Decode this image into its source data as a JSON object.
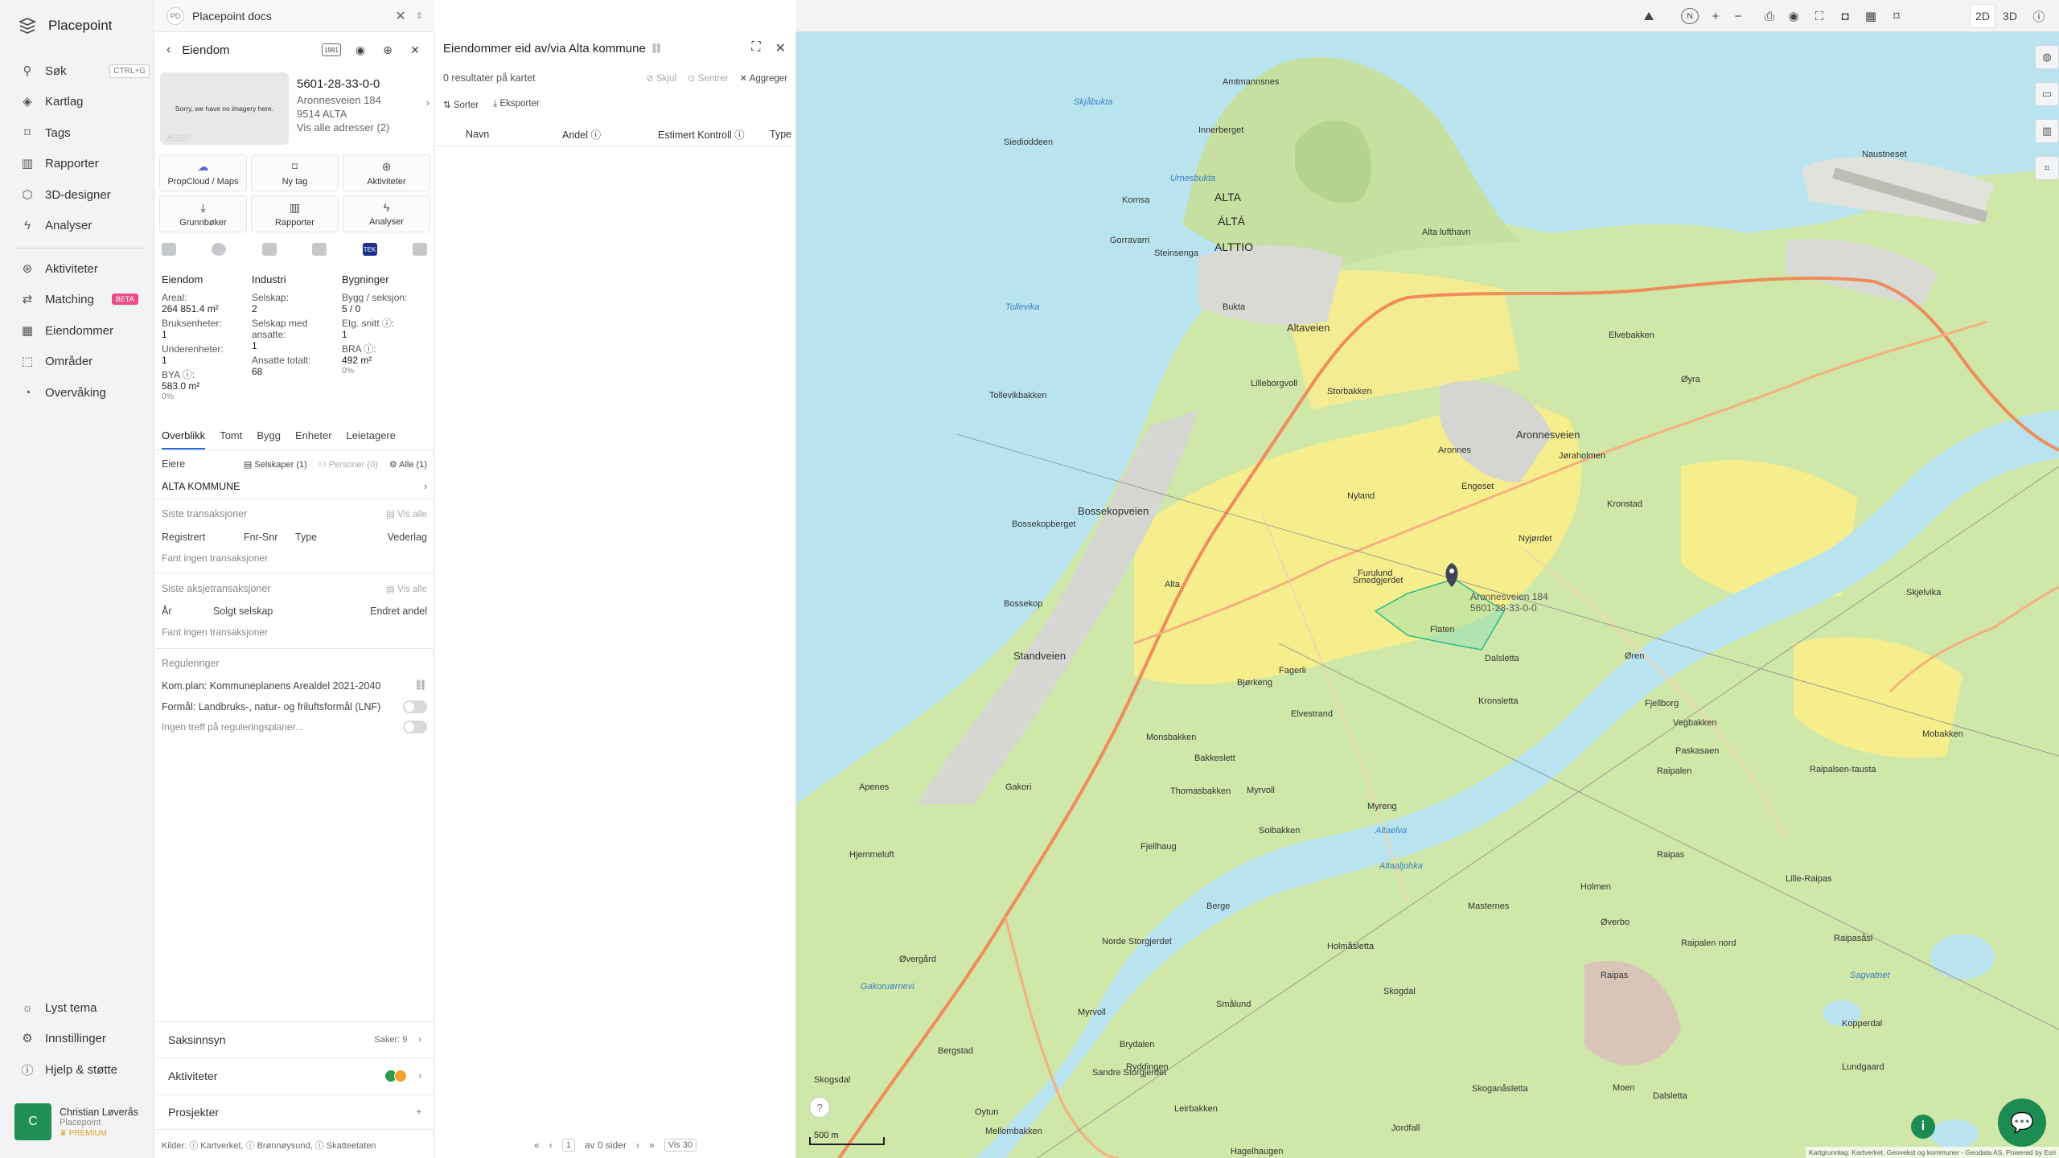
{
  "app": {
    "name": "Placepoint"
  },
  "nav": {
    "items": [
      {
        "label": "Søk",
        "icon": "search-icon",
        "shortcut": "CTRL+G"
      },
      {
        "label": "Kartlag",
        "icon": "layers-icon"
      },
      {
        "label": "Tags",
        "icon": "bookmark-icon"
      },
      {
        "label": "Rapporter",
        "icon": "bar-chart-icon"
      },
      {
        "label": "3D-designer",
        "icon": "cube-icon"
      },
      {
        "label": "Analyser",
        "icon": "bolt-icon"
      },
      {
        "label": "Aktiviteter",
        "icon": "activity-icon"
      },
      {
        "label": "Matching",
        "icon": "matching-icon",
        "badge": "BETA"
      },
      {
        "label": "Eiendommer",
        "icon": "building-icon"
      },
      {
        "label": "Områder",
        "icon": "area-icon"
      },
      {
        "label": "Overvåking",
        "icon": "monitor-icon"
      }
    ],
    "bottom": [
      {
        "label": "Lyst tema",
        "icon": "sun-icon"
      },
      {
        "label": "Innstillinger",
        "icon": "gear-icon"
      },
      {
        "label": "Hjelp & støtte",
        "icon": "help-icon"
      }
    ]
  },
  "user": {
    "initial": "C",
    "name": "Christian Løverås",
    "org": "Placepoint",
    "plan": "PREMIUM"
  },
  "docs_tab": {
    "badge": "PD",
    "title": "Placepoint docs"
  },
  "property": {
    "header": "Eiendom",
    "badge": "1981",
    "no_image": "Sorry, we have no imagery here.",
    "image_credit": "Google",
    "id": "5601-28-33-0-0",
    "street": "Aronnesveien 184",
    "postal": "9514 ALTA",
    "all_addresses": "Vis alle adresser (2)",
    "buttons": [
      "PropCloud / Maps",
      "Ny tag",
      "Aktiviteter",
      "Grunnbøker",
      "Rapporter",
      "Analyser"
    ],
    "source_tek": "TEK",
    "stats": {
      "eiendom": {
        "heading": "Eiendom",
        "areal_label": "Areal:",
        "areal": "264 851.4 m²",
        "bruks_label": "Bruksenheter:",
        "bruks": "1",
        "under_label": "Underenheter:",
        "under": "1",
        "bya_label": "BYA ⓘ:",
        "bya": "583.0 m²",
        "bya_pct": "0%"
      },
      "industri": {
        "heading": "Industri",
        "selskap_label": "Selskap:",
        "selskap": "2",
        "ansatte_label": "Selskap med ansatte:",
        "ansatte": "1",
        "total_label": "Ansatte totalt:",
        "total": "68"
      },
      "bygninger": {
        "heading": "Bygninger",
        "bygg_label": "Bygg / seksjon:",
        "bygg": "5 / 0",
        "etg_label": "Etg. snitt ⓘ:",
        "etg": "1",
        "bra_label": "BRA ⓘ:",
        "bra": "492 m²",
        "bra_pct": "0%"
      }
    },
    "tabs": [
      "Overblikk",
      "Tomt",
      "Bygg",
      "Enheter",
      "Leietagere"
    ],
    "owners": {
      "label": "Eiere",
      "companies": "Selskaper (1)",
      "persons": "Personer (0)",
      "all": "Alle (1)",
      "owner": "ALTA KOMMUNE"
    },
    "transactions": {
      "label": "Siste transaksjoner",
      "show_all": "Vis alle",
      "cols": [
        "Registrert",
        "Fnr-Snr",
        "Type",
        "Vederlag"
      ],
      "empty": "Fant ingen transaksjoner"
    },
    "share_tx": {
      "label": "Siste aksjetransaksjoner",
      "show_all": "Vis alle",
      "cols": [
        "År",
        "Solgt selskap",
        "Endret andel"
      ],
      "empty": "Fant ingen transaksjoner"
    },
    "regulations": {
      "label": "Reguleringer",
      "komplan": "Kom.plan: Kommuneplanens Arealdel 2021-2040",
      "formal": "Formål: Landbruks-, natur- og friluftsformål (LNF)",
      "none": "Ingen treff på reguleringsplaner..."
    },
    "accordion": [
      {
        "label": "Saksinnsyn",
        "extra": "Saker: 9"
      },
      {
        "label": "Aktiviteter",
        "extra": ""
      },
      {
        "label": "Prosjekter",
        "extra": "+"
      }
    ],
    "sources": "Kilder: ⓘ Kartverket, ⓘ Brønnøysund, ⓘ Skatteetaten"
  },
  "results": {
    "title": "Eiendommer eid av/via Alta kommune",
    "count": "0 resultater på kartet",
    "hide": "Skjul",
    "center": "Sentrer",
    "aggregate": "Aggreger",
    "sort": "Sorter",
    "export": "Eksporter",
    "columns": [
      "Navn",
      "Andel ⓘ",
      "Estimert Kontroll ⓘ",
      "Type"
    ],
    "pager": {
      "page": "1",
      "of": "av 0 sider",
      "per_page": "Vis 30"
    }
  },
  "toolbar": {
    "north": "N",
    "mode_2d": "2D",
    "mode_3d": "3D"
  },
  "map": {
    "scale": "500 m",
    "attribution": "Kartgrunnlag: Kartverket, Geovekst og kommuner - Geodata AS, Powered by Esri",
    "property_label_1": "Aronnesveien 184",
    "property_label_2": "5601-28-33-0-0",
    "labels": [
      "Amtmannsnes",
      "Skjåbukta",
      "Innerberget",
      "Siedioddeen",
      "Naustneset",
      "Urnesbukta",
      "Komsa",
      "ALTA",
      "ÁLTÁ",
      "ALTTIO",
      "Gorravarri",
      "Alta lufthavn",
      "Steinsenga",
      "Bukta",
      "Tollevika",
      "Altaveien",
      "Elvebakken",
      "Øyra",
      "Tollevikbakken",
      "Lilleborgvoll",
      "Storbakken",
      "Aronnesveien",
      "Aronnes",
      "Jøraholmen",
      "Kronstad",
      "Bossekopveien",
      "Bossekopberget",
      "Nyland",
      "Engeset",
      "Nyjørdet",
      "Smedgjerdet",
      "Furulund",
      "Bossekop",
      "Flaten",
      "Dalsletta",
      "Skjelvika",
      "Standveien",
      "Alta",
      "Øren",
      "Fagerli",
      "Bjørkeng",
      "Kronsletta",
      "Fjellborg",
      "Vegbakken",
      "Elvestrand",
      "Elvestrand",
      "Mobakken",
      "Paskasaen",
      "Monsbakken",
      "Bakkeslett",
      "Raipalsen-tausta",
      "Apenes",
      "Gakori",
      "Thomasbakken",
      "Myrvoll",
      "Myreng",
      "Raipalen",
      "Soibakken",
      "Hjemmeluft",
      "Fjellhaug",
      "Raipas",
      "Lille-Raipas",
      "Altaelva",
      "Holmen",
      "Berge",
      "Altaaljohka",
      "Øvergård",
      "Norde Storgjerdet",
      "Masternes",
      "Øverbo",
      "Gakoruørnevi",
      "Raipasåsl",
      "Holmåsletta",
      "Raipalen nord",
      "Raipas",
      "Smålund",
      "Skogdal",
      "Myrvoll",
      "Brydalen",
      "Bergstad",
      "Sandre Storgjerdet",
      "Ryddingen",
      "Skoganåsletta",
      "Kopperdal",
      "Sagvatnet",
      "Skogsdal",
      "Moen",
      "Dalsletta",
      "Lundgaard",
      "Leirbakken",
      "Jordfall",
      "Mellombakken",
      "Oytun",
      "Hagelhaugen"
    ]
  }
}
